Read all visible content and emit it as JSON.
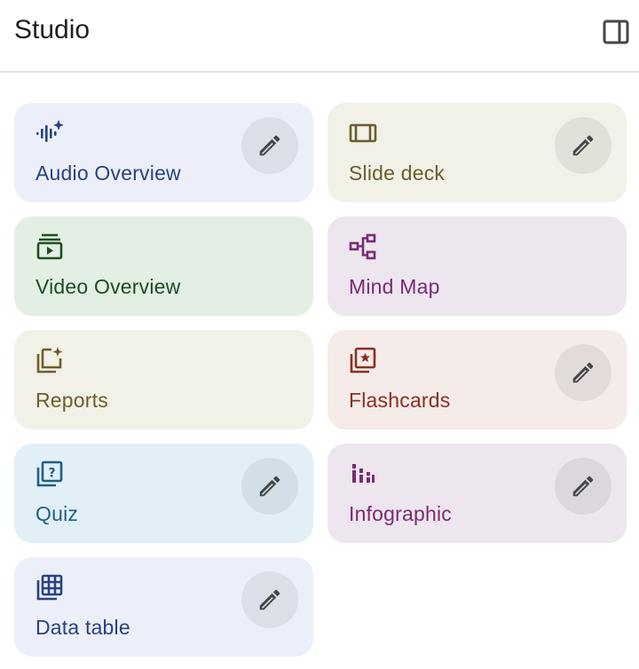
{
  "header": {
    "title": "Studio"
  },
  "cards": [
    {
      "id": "audio-overview",
      "label": "Audio Overview",
      "icon": "audio-sparkle-icon",
      "editable": true,
      "accent": "#27437e"
    },
    {
      "id": "slide-deck",
      "label": "Slide deck",
      "icon": "slides-icon",
      "editable": true,
      "accent": "#6b5d2b"
    },
    {
      "id": "video-overview",
      "label": "Video Overview",
      "icon": "video-stack-icon",
      "editable": false,
      "accent": "#1d4d24"
    },
    {
      "id": "mind-map",
      "label": "Mind Map",
      "icon": "mind-map-icon",
      "editable": false,
      "accent": "#7a2b73"
    },
    {
      "id": "reports",
      "label": "Reports",
      "icon": "reports-icon",
      "editable": false,
      "accent": "#6b5d2b"
    },
    {
      "id": "flashcards",
      "label": "Flashcards",
      "icon": "flashcards-icon",
      "editable": true,
      "accent": "#8a2f22"
    },
    {
      "id": "quiz",
      "label": "Quiz",
      "icon": "quiz-icon",
      "editable": true,
      "accent": "#1f5f86"
    },
    {
      "id": "infographic",
      "label": "Infographic",
      "icon": "infographic-icon",
      "editable": true,
      "accent": "#7a2b73"
    },
    {
      "id": "data-table",
      "label": "Data table",
      "icon": "data-table-icon",
      "editable": true,
      "accent": "#27437e"
    }
  ]
}
